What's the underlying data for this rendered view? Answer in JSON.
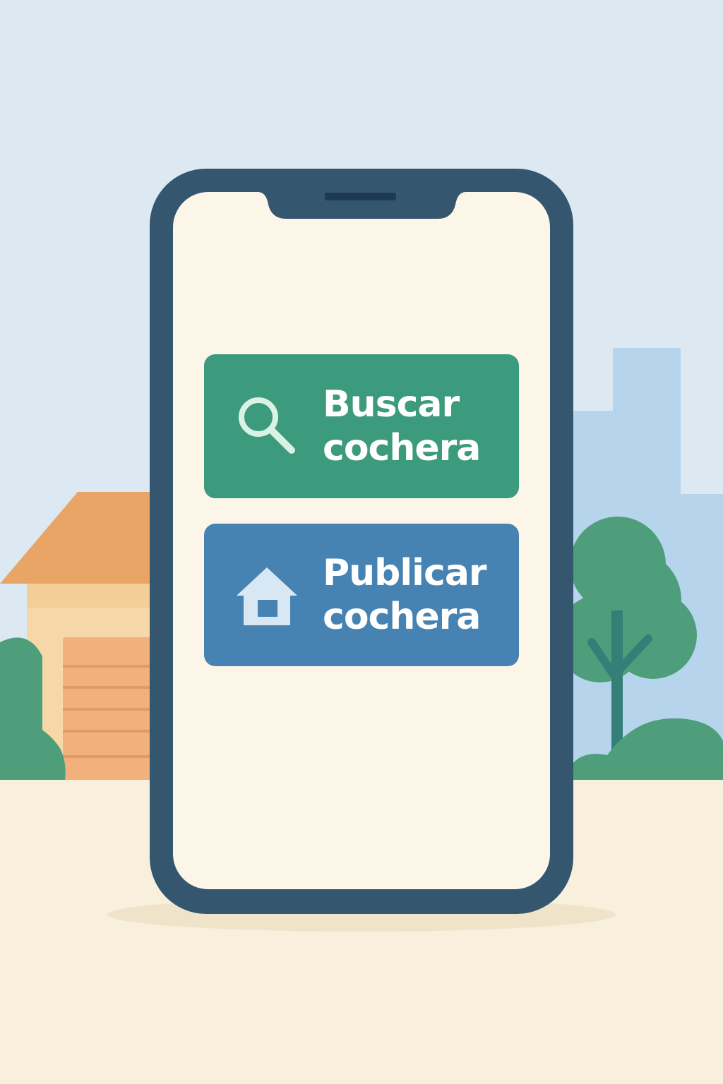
{
  "colors": {
    "sky": "#dde9f2",
    "ground": "#f8efdd",
    "phone_frame": "#34566f",
    "phone_screen": "#fcf6e9",
    "search_button": "#3c9a7d",
    "publish_button": "#4683b3",
    "search_icon": "#d9f2e4",
    "publish_icon": "#d7e7f4",
    "house_roof": "#e9a566",
    "house_wall": "#f6d8a8",
    "garage_door": "#f1b07c",
    "bushes": "#4f9e7b",
    "city_buildings": "#b6d5ec",
    "tree_trunk": "#347f78"
  },
  "actions": {
    "search": {
      "line1": "Buscar",
      "line2": "cochera",
      "icon": "search-icon"
    },
    "publish": {
      "line1": "Publicar",
      "line2": "cochera",
      "icon": "house-icon"
    }
  }
}
